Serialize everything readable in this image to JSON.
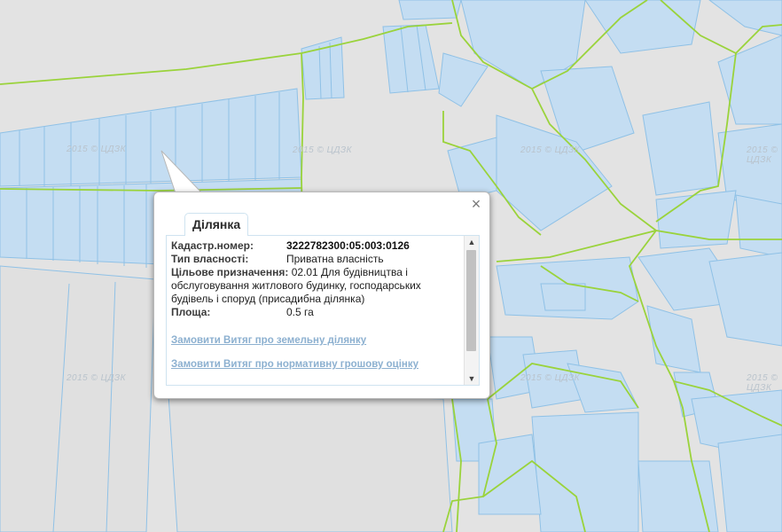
{
  "watermark": "2015 © ЦДЗК",
  "popup": {
    "close_symbol": "×",
    "tab_label": "Ділянка",
    "fields": {
      "cadastral_label": "Кадастр.номер:",
      "cadastral_value": "3222782300:05:003:0126",
      "ownership_label": "Тип власності:",
      "ownership_value": "Приватна власність",
      "purpose_label": "Цільове призначення:",
      "purpose_value": "02.01 Для будівництва і обслуговування житлового будинку, господарських будівель і споруд (присадибна ділянка)",
      "area_label": "Площа:",
      "area_value": "0.5 га"
    },
    "links": {
      "land_extract": "Замовити Витяг про земельну ділянку",
      "valuation_extract": "Замовити Витяг про нормативну грошову оцінку"
    }
  },
  "colors": {
    "background": "#e3e3e3",
    "parcel_fill": "#c4ddf2",
    "parcel_stroke": "#8fc1e6",
    "boundary": "#9ad33b",
    "link": "#8cb0d0"
  }
}
